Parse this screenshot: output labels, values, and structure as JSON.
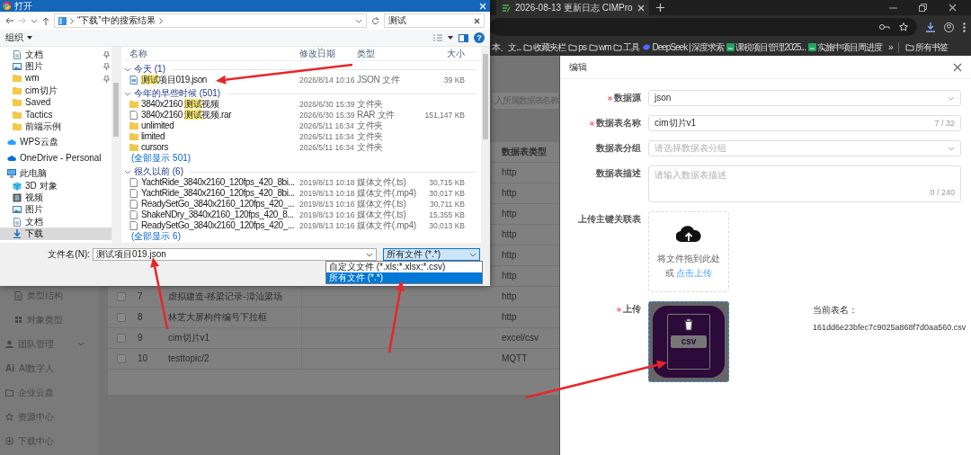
{
  "browser": {
    "tab": {
      "title": "2026-08-13 更新日志 CIMPro"
    },
    "bookmarks": [
      {
        "label": "本、文...",
        "kind": "plain"
      },
      {
        "label": "收藏夹栏",
        "kind": "folder"
      },
      {
        "label": "ps",
        "kind": "folder"
      },
      {
        "label": "wm",
        "kind": "folder"
      },
      {
        "label": "工具",
        "kind": "folder"
      },
      {
        "label": "DeepSeek | 深度求索",
        "kind": "site"
      },
      {
        "label": "课税项目管理2025...",
        "kind": "sheet"
      },
      {
        "label": "实施中项目周进度",
        "kind": "sheet"
      },
      {
        "label": "»",
        "kind": "overflow"
      },
      {
        "label": "所有书签",
        "kind": "folder"
      }
    ]
  },
  "page": {
    "search": {
      "placeholder": "入所属数据表名称"
    },
    "sidebar": {
      "sub_items": [
        {
          "label": "类型结构",
          "kind": "doc"
        },
        {
          "label": "对象类型",
          "kind": "grid"
        }
      ],
      "items": [
        {
          "label": "团队管理",
          "kind": "person",
          "expanded": false
        },
        {
          "label": "AI数字人",
          "kind": "text",
          "icon_text": "Ai"
        },
        {
          "label": "企业云盘",
          "kind": "folder"
        },
        {
          "label": "资源中心",
          "kind": "star"
        },
        {
          "label": "下载中心",
          "kind": "plus"
        }
      ]
    },
    "table": {
      "columns": [
        "数据表类型"
      ],
      "rows": [
        {
          "type": "http"
        },
        {
          "type": "http"
        },
        {
          "type": "http"
        },
        {
          "type": "http"
        },
        {
          "type": "http"
        },
        {
          "type": "http"
        },
        {
          "checked": false,
          "number": "7",
          "name": "虚拟建造-移梁记录-漳汕梁场",
          "type": "http"
        },
        {
          "checked": false,
          "number": "8",
          "name": "林芝大屏构件编号下拉框",
          "type": "http"
        },
        {
          "checked": false,
          "number": "9",
          "name": "cim切片v1",
          "type": "excel/csv"
        },
        {
          "checked": false,
          "number": "10",
          "name": "testtopic/2",
          "type": "MQTT"
        }
      ]
    }
  },
  "drawer": {
    "title": "编辑",
    "fields": [
      {
        "kind": "select",
        "label": "数据源",
        "required": true,
        "value": "json"
      },
      {
        "kind": "input",
        "label": "数据表名称",
        "required": true,
        "value": "cim切片v1",
        "counter": "7 / 32"
      },
      {
        "kind": "select",
        "label": "数据表分组",
        "required": false,
        "placeholder": "请选择数据表分组"
      },
      {
        "kind": "textarea",
        "label": "数据表描述",
        "required": false,
        "placeholder": "请输入数据表描述",
        "counter": "0 / 240"
      },
      {
        "kind": "dragger",
        "label": "上传主键关联表",
        "required": false,
        "hint": "将文件拖到此处",
        "or_text": "或",
        "link": "点击上传"
      },
      {
        "kind": "file",
        "label": "上传",
        "required": true,
        "file_label": "csv",
        "current_label": "当前表名：",
        "current_value": "161dd6e23bfec7c9025a868f7d0aa560.csv"
      }
    ]
  },
  "dialog": {
    "title": "打开",
    "path": "“下载”中的搜索结果",
    "search": "测试",
    "organize": "组织",
    "help": "?",
    "nav_pane": {
      "quick_access_children": [
        {
          "label": "文档",
          "kind": "doc",
          "pinned": true,
          "selected": false
        },
        {
          "label": "图片",
          "kind": "image",
          "pinned": true,
          "selected": false
        },
        {
          "label": "wm",
          "kind": "folder",
          "pinned": true,
          "selected": false
        },
        {
          "label": "cim切片",
          "kind": "folder",
          "pinned": false,
          "selected": false
        },
        {
          "label": "Saved",
          "kind": "folder",
          "pinned": false,
          "selected": false
        },
        {
          "label": "Tactics",
          "kind": "folder",
          "pinned": false,
          "selected": false
        },
        {
          "label": "前端示例",
          "kind": "folder",
          "pinned": false,
          "selected": false
        }
      ],
      "locations": [
        {
          "label": "WPS云盘",
          "kind": "cloud",
          "selected": false
        },
        {
          "label": "OneDrive - Personal",
          "kind": "onedrive",
          "selected": false
        },
        {
          "label": "此电脑",
          "kind": "pc",
          "selected": false,
          "children": [
            {
              "label": "3D 对象",
              "kind": "cube",
              "selected": false
            },
            {
              "label": "视频",
              "kind": "video",
              "selected": false
            },
            {
              "label": "图片",
              "kind": "image",
              "selected": false
            },
            {
              "label": "文档",
              "kind": "doc",
              "selected": false
            },
            {
              "label": "下载",
              "kind": "download",
              "selected": true
            }
          ]
        }
      ]
    },
    "columns": [
      "名称",
      "修改日期",
      "类型",
      "大小"
    ],
    "groups": [
      {
        "label": "今天 (1)",
        "expanded": true,
        "items": [
          {
            "name": [
              {
                "text": "测试",
                "highlighted": true
              },
              {
                "text": "项目019.json",
                "highlighted": false
              }
            ],
            "kind": "json",
            "date": "2026/8/14 10:16",
            "type": "JSON 文件",
            "size": "39 KB"
          }
        ]
      },
      {
        "label": "今年的早些时候 (501)",
        "expanded": true,
        "items": [
          {
            "name": [
              {
                "text": "3840x2160 ",
                "highlighted": false
              },
              {
                "text": "测试",
                "highlighted": true
              },
              {
                "text": "视频",
                "highlighted": false
              }
            ],
            "kind": "folder",
            "date": "2026/6/30 15:39",
            "type": "文件夹"
          },
          {
            "name": [
              {
                "text": "3840x2160 ",
                "highlighted": false
              },
              {
                "text": "测试",
                "highlighted": true
              },
              {
                "text": "视频.rar",
                "highlighted": false
              }
            ],
            "kind": "file",
            "date": "2026/6/30 15:39",
            "type": "RAR 文件",
            "size": "151,147 KB"
          },
          {
            "name": [
              {
                "text": "unlimited",
                "highlighted": false
              }
            ],
            "kind": "folder",
            "date": "2026/5/11 16:34",
            "type": "文件夹"
          },
          {
            "name": [
              {
                "text": "limited",
                "highlighted": false
              }
            ],
            "kind": "folder",
            "date": "2026/5/11 16:34",
            "type": "文件夹"
          },
          {
            "name": [
              {
                "text": "cursors",
                "highlighted": false
              }
            ],
            "kind": "folder",
            "date": "2026/5/11 16:34",
            "type": "文件夹"
          }
        ],
        "show_all": "(全部显示 501)"
      },
      {
        "label": "很久以前 (6)",
        "expanded": true,
        "items": [
          {
            "name": [
              {
                "text": "YachtRide_3840x2160_120fps_420_8bi...",
                "highlighted": false
              }
            ],
            "kind": "file",
            "date": "2019/8/13 10:18",
            "type": "媒体文件(.ts)",
            "size": "30,715 KB"
          },
          {
            "name": [
              {
                "text": "YachtRide_3840x2160_120fps_420_8bi...",
                "highlighted": false
              }
            ],
            "kind": "file",
            "date": "2019/8/13 10:18",
            "type": "媒体文件(.mp4)",
            "size": "30,017 KB"
          },
          {
            "name": [
              {
                "text": "ReadySetGo_3840x2160_120fps_420_...",
                "highlighted": false
              }
            ],
            "kind": "file",
            "date": "2019/8/13 10:16",
            "type": "媒体文件(.ts)",
            "size": "30,711 KB"
          },
          {
            "name": [
              {
                "text": "ShakeNDry_3840x2160_120fps_420_8...",
                "highlighted": false
              }
            ],
            "kind": "file",
            "date": "2019/8/13 10:16",
            "type": "媒体文件(.ts)",
            "size": "15,355 KB"
          },
          {
            "name": [
              {
                "text": "ReadySetGo_3840x2160_120fps_420_...",
                "highlighted": false
              }
            ],
            "kind": "file",
            "date": "2019/8/13 10:16",
            "type": "媒体文件(.mp4)",
            "size": "30,013 KB"
          }
        ],
        "show_all": "(全部显示 6)"
      }
    ],
    "filename_label": "文件名(N):",
    "filename": "测试项目019.json",
    "file_type": {
      "value": "所有文件 (*.*)",
      "expanded": true,
      "options": [
        {
          "label": "自定义文件 (*.xls;*.xlsx;*.csv)",
          "selected": false
        },
        {
          "label": "所有文件 (*.*)",
          "selected": true
        }
      ]
    }
  }
}
